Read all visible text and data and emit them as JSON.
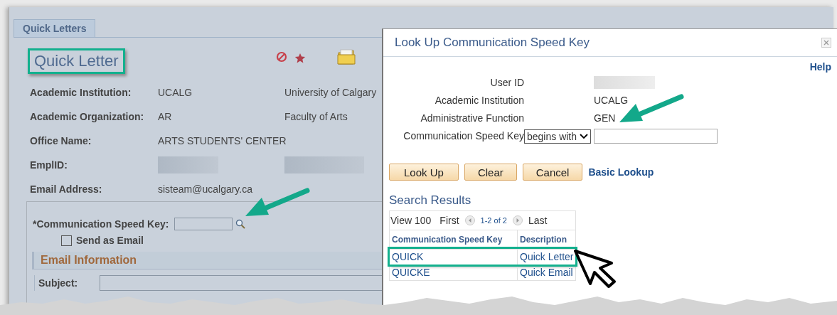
{
  "tabs": [
    {
      "label": "Quick Letters",
      "selected": true
    }
  ],
  "page": {
    "title": "Quick Letter",
    "title_highlighted": true,
    "fields": [
      {
        "label": "Academic Institution:",
        "kind": "text",
        "value": "UCALG",
        "value_2": "University of Calgary"
      },
      {
        "label": "Academic Organization:",
        "kind": "text",
        "value": "AR",
        "value_2": "Faculty of Arts"
      },
      {
        "label": "Office Name:",
        "kind": "text",
        "value": "ARTS STUDENTS' CENTER"
      },
      {
        "label": "EmplID:",
        "kind": "redacted"
      },
      {
        "label": "Email Address:",
        "kind": "text",
        "value": "sisteam@ucalgary.ca"
      }
    ],
    "speed_key": {
      "label": "*Communication Speed Key:"
    },
    "send_as_email": {
      "label": "Send as Email",
      "checked": false
    },
    "section": {
      "title": "Email Information",
      "subject_label": "Subject:"
    }
  },
  "dialog": {
    "title": "Look Up Communication Speed Key",
    "help": "Help",
    "criteria": [
      {
        "label": "User ID",
        "kind": "redacted"
      },
      {
        "label": "Academic Institution",
        "kind": "text",
        "value": "UCALG"
      },
      {
        "label": "Administrative Function",
        "kind": "text",
        "value": "GEN"
      },
      {
        "label": "Communication Speed Key",
        "kind": "search",
        "operator": "begins with"
      }
    ],
    "buttons": [
      "Look Up",
      "Clear",
      "Cancel"
    ],
    "basic_lookup": "Basic Lookup",
    "results_title": "Search Results",
    "nav": {
      "view": "View 100",
      "first": "First",
      "range": "1-2 of 2",
      "last": "Last"
    },
    "columns": [
      "Communication Speed Key",
      "Description"
    ],
    "rows": [
      {
        "key": "QUICK",
        "description": "Quick Letter",
        "highlighted": true
      },
      {
        "key": "QUICKE",
        "description": "Quick Email",
        "highlighted": false
      }
    ]
  }
}
